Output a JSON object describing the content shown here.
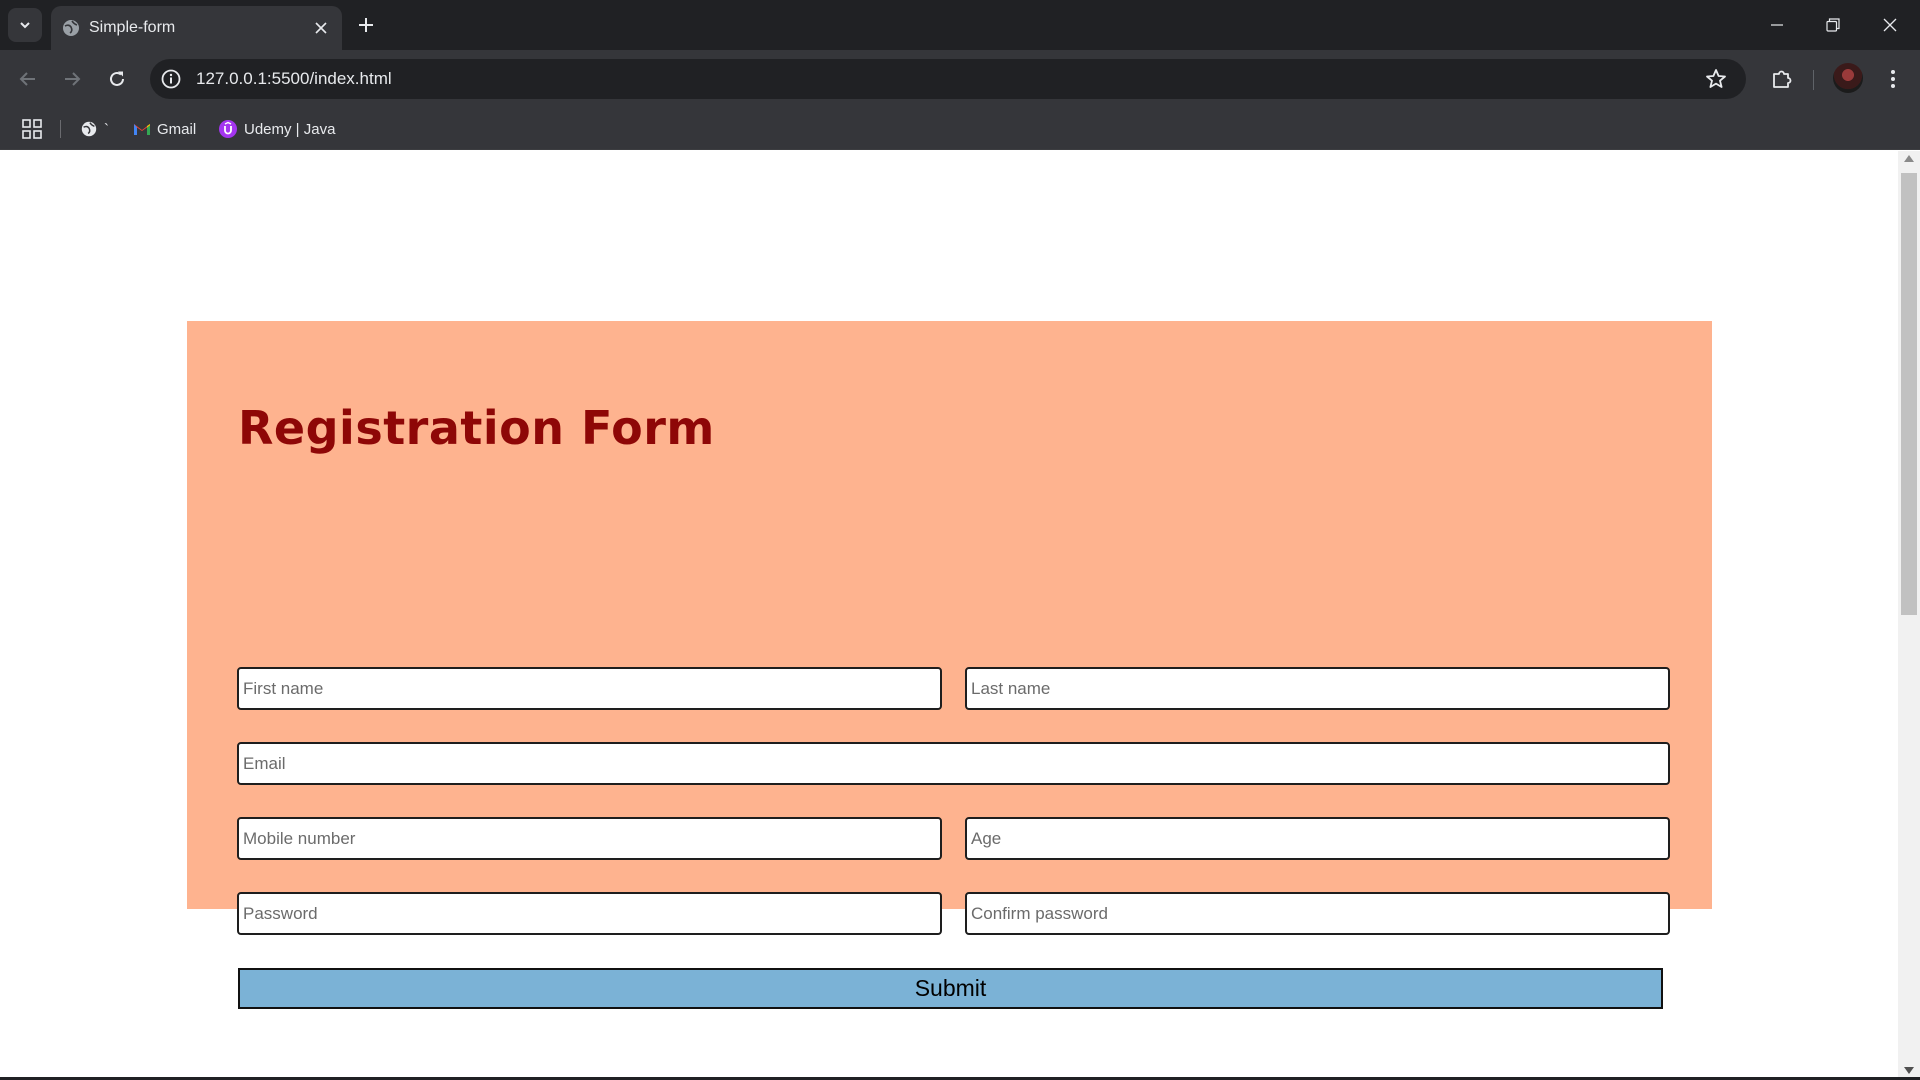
{
  "browser": {
    "tab_title": "Simple-form",
    "url": "127.0.0.1:5500/index.html",
    "bookmarks": [
      {
        "label": "`",
        "icon": "globe-icon"
      },
      {
        "label": "Gmail",
        "icon": "gmail-icon"
      },
      {
        "label": "Udemy | Java",
        "icon": "udemy-icon"
      }
    ]
  },
  "form": {
    "title": "Registration Form",
    "fields": {
      "first_name": "First name",
      "last_name": "Last name",
      "email": "Email",
      "mobile": "Mobile number",
      "age": "Age",
      "password": "Password",
      "confirm_password": "Confirm password"
    },
    "submit_label": "Submit"
  },
  "colors": {
    "card_background": "#feb38f",
    "title": "#8e0707",
    "submit_background": "#7bb2d6"
  }
}
